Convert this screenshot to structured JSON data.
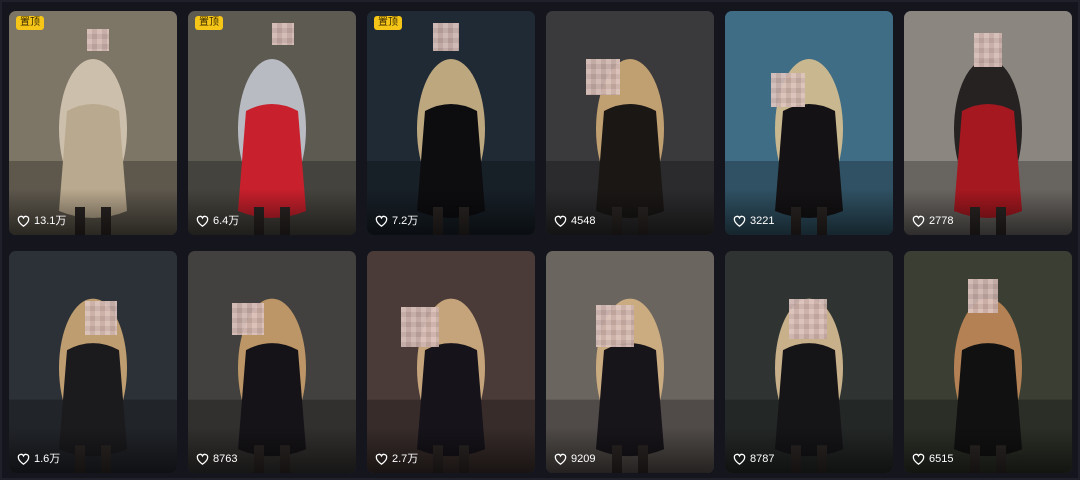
{
  "grid": {
    "items": [
      {
        "likes": "13.1万",
        "pinned": true,
        "pin_label": "置顶",
        "bg": "#7d7566",
        "fg": "#d9cdb8",
        "accent": "#b9a98e"
      },
      {
        "likes": "6.4万",
        "pinned": true,
        "pin_label": "置顶",
        "bg": "#5d5a52",
        "fg": "#c8ccd6",
        "accent": "#c8202c"
      },
      {
        "likes": "7.2万",
        "pinned": true,
        "pin_label": "置顶",
        "bg": "#1f2a35",
        "fg": "#d8bd8c",
        "accent": "#0d0d10"
      },
      {
        "likes": "4548",
        "pinned": false,
        "pin_label": "",
        "bg": "#3a3a3c",
        "fg": "#d8b27a",
        "accent": "#1a1715"
      },
      {
        "likes": "3221",
        "pinned": false,
        "pin_label": "",
        "bg": "#3f6d85",
        "fg": "#e2c591",
        "accent": "#141214"
      },
      {
        "likes": "2778",
        "pinned": false,
        "pin_label": "",
        "bg": "#8b8680",
        "fg": "#141112",
        "accent": "#a61820"
      },
      {
        "likes": "1.6万",
        "pinned": false,
        "pin_label": "",
        "bg": "#2c3137",
        "fg": "#d8b27a",
        "accent": "#1b1a1d"
      },
      {
        "likes": "8763",
        "pinned": false,
        "pin_label": "",
        "bg": "#43413f",
        "fg": "#d1a66e",
        "accent": "#151317"
      },
      {
        "likes": "2.7万",
        "pinned": false,
        "pin_label": "",
        "bg": "#4a3b38",
        "fg": "#dbb787",
        "accent": "#16131a"
      },
      {
        "likes": "9209",
        "pinned": false,
        "pin_label": "",
        "bg": "#6b6560",
        "fg": "#dcb886",
        "accent": "#18151a"
      },
      {
        "likes": "8787",
        "pinned": false,
        "pin_label": "",
        "bg": "#2f3433",
        "fg": "#e2c79a",
        "accent": "#151417"
      },
      {
        "likes": "6515",
        "pinned": false,
        "pin_label": "",
        "bg": "#3a3e33",
        "fg": "#c98d5a",
        "accent": "#111112"
      }
    ]
  },
  "icons": {
    "like": "heart-outline-icon"
  },
  "colors": {
    "page_bg": "#15161d",
    "pin_bg": "#f5c518",
    "like_text": "#ffffff"
  }
}
